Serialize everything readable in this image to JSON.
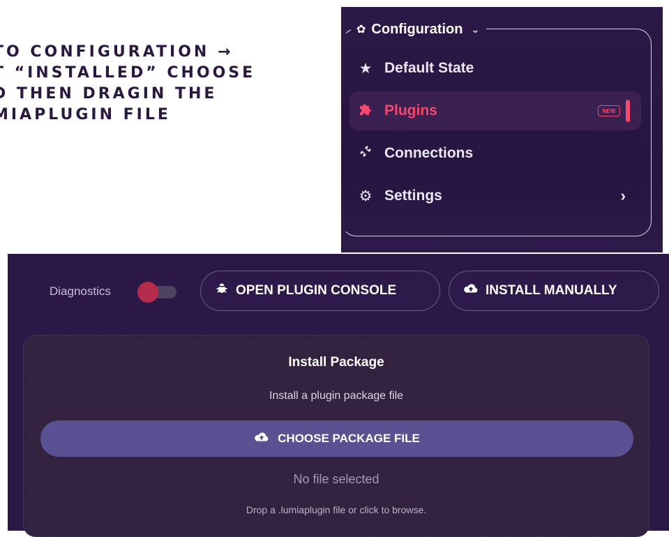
{
  "instructions": {
    "lines": [
      "TO CONFIGURATION →",
      "T “INSTALLED” CHOOSE",
      "D THEN DRAGIN THE",
      "MIAPLUGIN FILE"
    ]
  },
  "menu": {
    "title": "Configuration",
    "items": [
      {
        "label": "Default State",
        "icon": "star-icon"
      },
      {
        "label": "Plugins",
        "icon": "puzzle-icon",
        "badge": "NEW",
        "active": true
      },
      {
        "label": "Connections",
        "icon": "plug-icon"
      },
      {
        "label": "Settings",
        "icon": "gear-icon"
      }
    ]
  },
  "plugin_panel": {
    "diagnostics_label": "Diagnostics",
    "open_console_label": "OPEN PLUGIN CONSOLE",
    "install_manually_label": "INSTALL MANUALLY",
    "dropzone": {
      "title": "Install Package",
      "subtitle": "Install a plugin package file",
      "choose_button_label": "CHOOSE PACKAGE FILE",
      "status": "No file selected",
      "hint": "Drop a .lumiaplugin file or click to browse."
    }
  },
  "colors": {
    "panel_bg": "#2b1846",
    "accent_pink": "#f5486e",
    "button_purple": "#5a5192",
    "toggle_knob": "#b52b4c"
  }
}
